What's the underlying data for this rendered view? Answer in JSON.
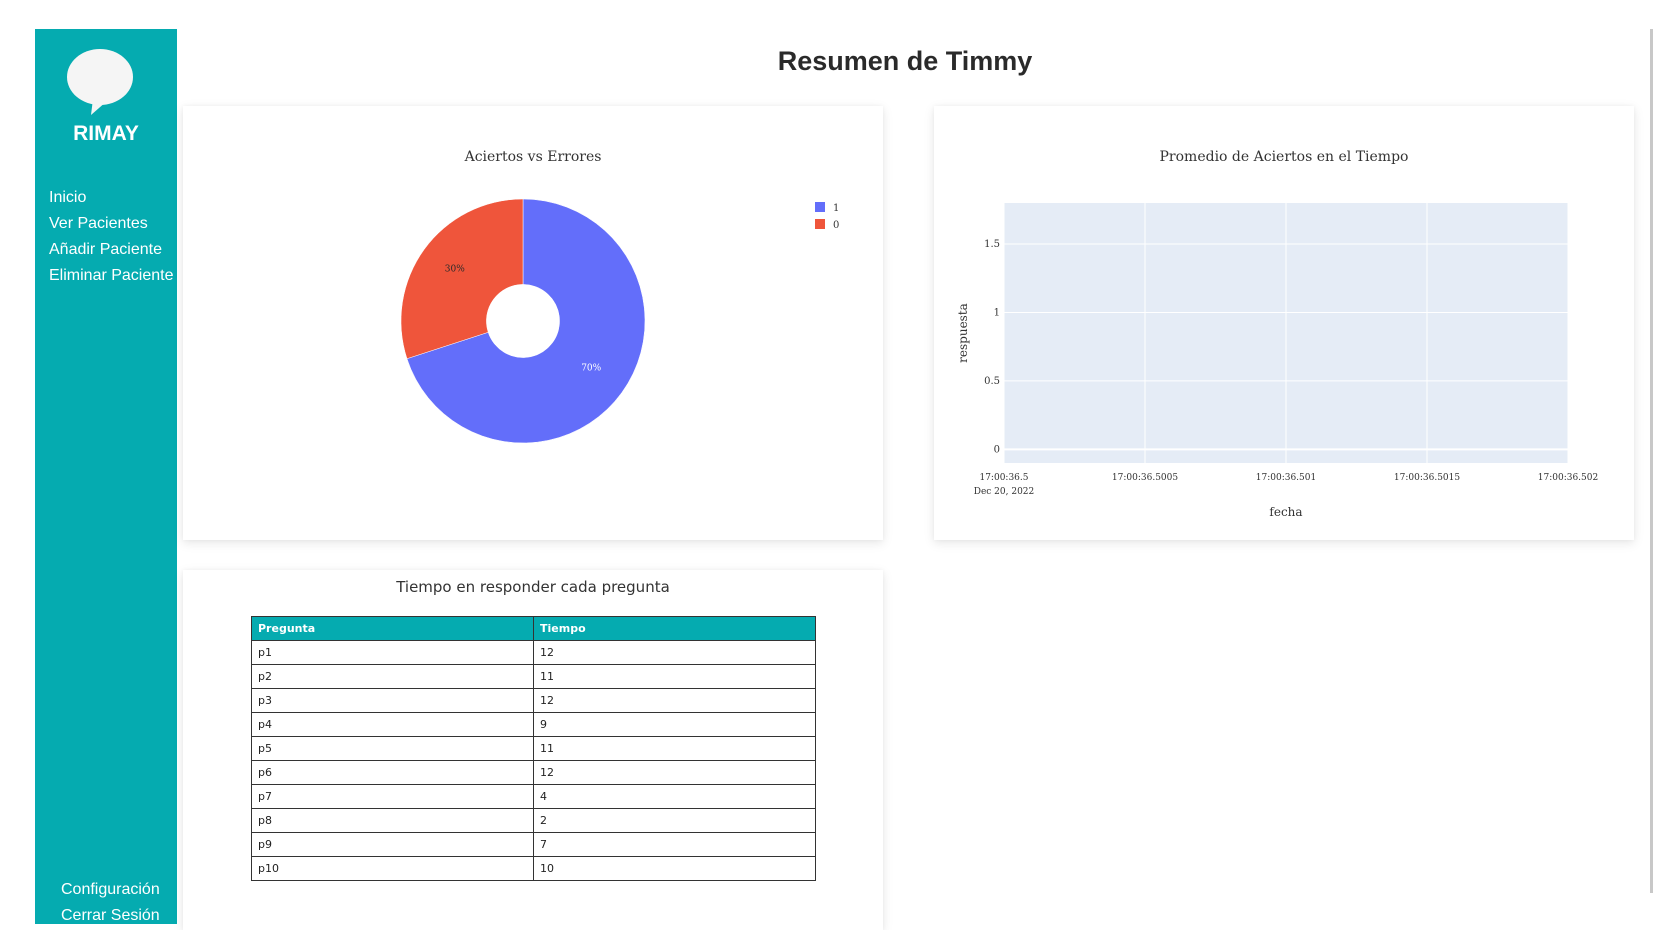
{
  "sidebar": {
    "brand": "RIMAY",
    "nav": [
      "Inicio",
      "Ver Pacientes",
      "Añadir Paciente",
      "Eliminar Paciente"
    ],
    "bottom_nav": [
      "Configuración",
      "Cerrar Sesión"
    ],
    "color": "#05abb0"
  },
  "page": {
    "title": "Resumen de Timmy"
  },
  "chart_data": [
    {
      "type": "pie",
      "title": "Aciertos vs Errores",
      "labels": [
        "1",
        "0"
      ],
      "values": [
        70,
        30
      ],
      "text": [
        "70%",
        "30%"
      ],
      "colors": [
        "#636efa",
        "#ef553b"
      ],
      "hole": 0.3,
      "legend_position": "top-right"
    },
    {
      "type": "line",
      "title": "Promedio de Aciertos en el Tiempo",
      "xlabel": "fecha",
      "ylabel": "respuesta",
      "x_ticks": [
        "17:00:36.5",
        "17:00:36.5005",
        "17:00:36.501",
        "17:00:36.5015",
        "17:00:36.502"
      ],
      "x_tick_sublabel": "Dec 20, 2022",
      "y_ticks": [
        0,
        0.5,
        1,
        1.5
      ],
      "ylim": [
        -0.1,
        1.8
      ],
      "grid": true,
      "series": []
    }
  ],
  "table": {
    "title": "Tiempo en responder cada pregunta",
    "columns": [
      "Pregunta",
      "Tiempo"
    ],
    "rows": [
      [
        "p1",
        "12"
      ],
      [
        "p2",
        "11"
      ],
      [
        "p3",
        "12"
      ],
      [
        "p4",
        "9"
      ],
      [
        "p5",
        "11"
      ],
      [
        "p6",
        "12"
      ],
      [
        "p7",
        "4"
      ],
      [
        "p8",
        "2"
      ],
      [
        "p9",
        "7"
      ],
      [
        "p10",
        "10"
      ]
    ]
  }
}
